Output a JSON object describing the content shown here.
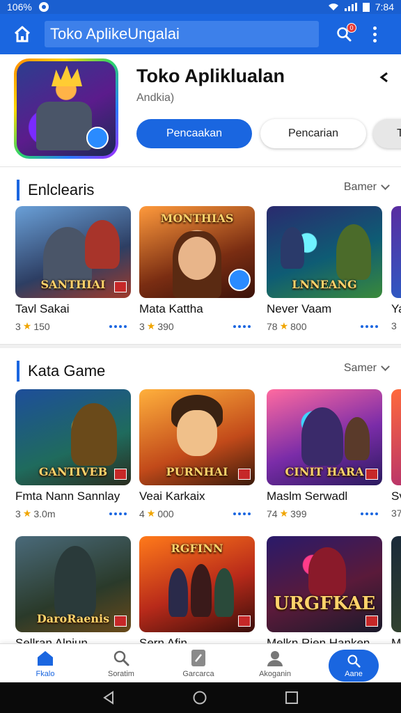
{
  "status_bar": {
    "left_text": "106%",
    "time": "7:84"
  },
  "app_bar": {
    "search_text": "Toko AplikeUngalai",
    "notification_count": "0"
  },
  "featured": {
    "title": "Toko Apliklualan",
    "subtitle": "Andkia)",
    "buttons": [
      "Pencaakan",
      "Pencarian",
      "T"
    ]
  },
  "sections": [
    {
      "title": "Enlclearis",
      "more_label": "Bamer",
      "cards": [
        {
          "name": "Tavl Sakai",
          "rating": "3",
          "count": "150",
          "caption": "SANTHIAI"
        },
        {
          "name": "Mata Kattha",
          "rating": "3",
          "count": "390",
          "caption": "MONTHIAS"
        },
        {
          "name": "Never Vaam",
          "rating": "78",
          "count": "800",
          "caption": "LNNEANG"
        },
        {
          "name": "Ya",
          "rating": "3",
          "count": "",
          "caption": ""
        }
      ]
    },
    {
      "title": "Kata Game",
      "more_label": "Samer",
      "cards": [
        {
          "name": "Fmta Nann Sannlay",
          "rating": "3",
          "count": "3.0m",
          "caption": "GANTIVEB"
        },
        {
          "name": "Veai Karkaix",
          "rating": "4",
          "count": "000",
          "caption": "PURNHAI"
        },
        {
          "name": "Maslm Serwadl",
          "rating": "74",
          "count": "399",
          "caption": "CINIT HARA"
        },
        {
          "name": "Sv",
          "rating": "37",
          "count": "",
          "caption": ""
        },
        {
          "name": "Sellran Alniun",
          "rating": "",
          "count": "",
          "caption": "DaroRaenis"
        },
        {
          "name": "Sern Afin",
          "rating": "",
          "count": "",
          "caption": "RGFINN"
        },
        {
          "name": "Melkn Rien Hanken",
          "rating": "",
          "count": "",
          "caption": "URGFKAE"
        },
        {
          "name": "M",
          "rating": "",
          "count": "",
          "caption": ""
        }
      ]
    }
  ],
  "bottom_nav": [
    {
      "label": "Fkalo",
      "icon": "home-icon"
    },
    {
      "label": "Soratim",
      "icon": "search-icon"
    },
    {
      "label": "Garcarca",
      "icon": "games-icon"
    },
    {
      "label": "Akoganin",
      "icon": "account-icon"
    },
    {
      "label": "Aane",
      "icon": "search-icon"
    }
  ],
  "colors": {
    "primary": "#1a66e0",
    "status_bar": "#1a5fd0"
  }
}
